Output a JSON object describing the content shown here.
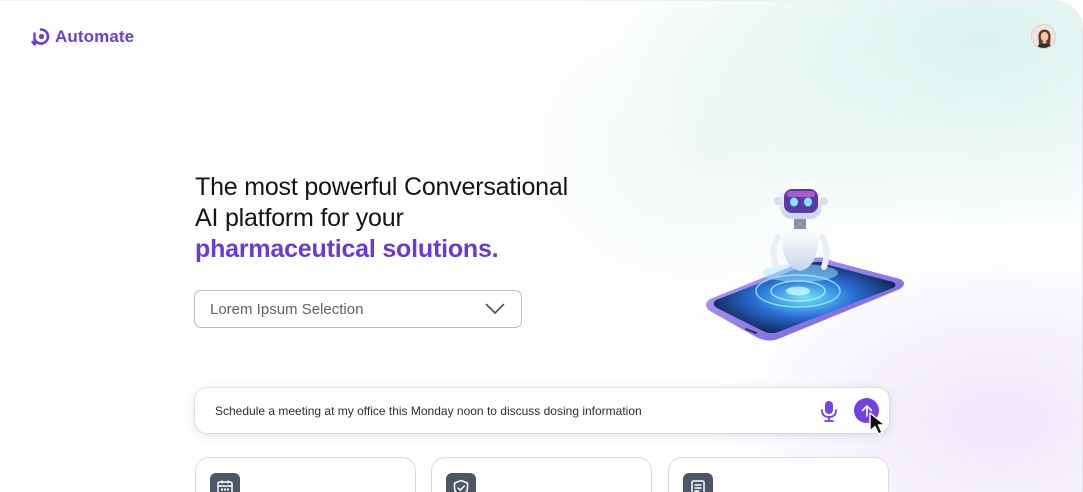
{
  "header": {
    "logo_text": "Automate",
    "avatar_icon": "user-avatar"
  },
  "hero": {
    "line1": "The most powerful Conversational",
    "line2": "AI platform for your",
    "accent": "pharmaceutical solutions."
  },
  "selector": {
    "value": "Lorem Ipsum Selection",
    "icon": "chevron-down-icon"
  },
  "prompt": {
    "text": "Schedule a meeting at my office this Monday noon to discuss dosing information",
    "mic_icon": "microphone-icon",
    "send_icon": "arrow-up-icon"
  },
  "cards": [
    {
      "icon": "calendar-icon"
    },
    {
      "icon": "shield-check-icon"
    },
    {
      "icon": "checklist-icon"
    }
  ],
  "colors": {
    "accent": "#6a3ad6",
    "send": "#7442e0",
    "card_icon_bg": "#4c5666"
  }
}
